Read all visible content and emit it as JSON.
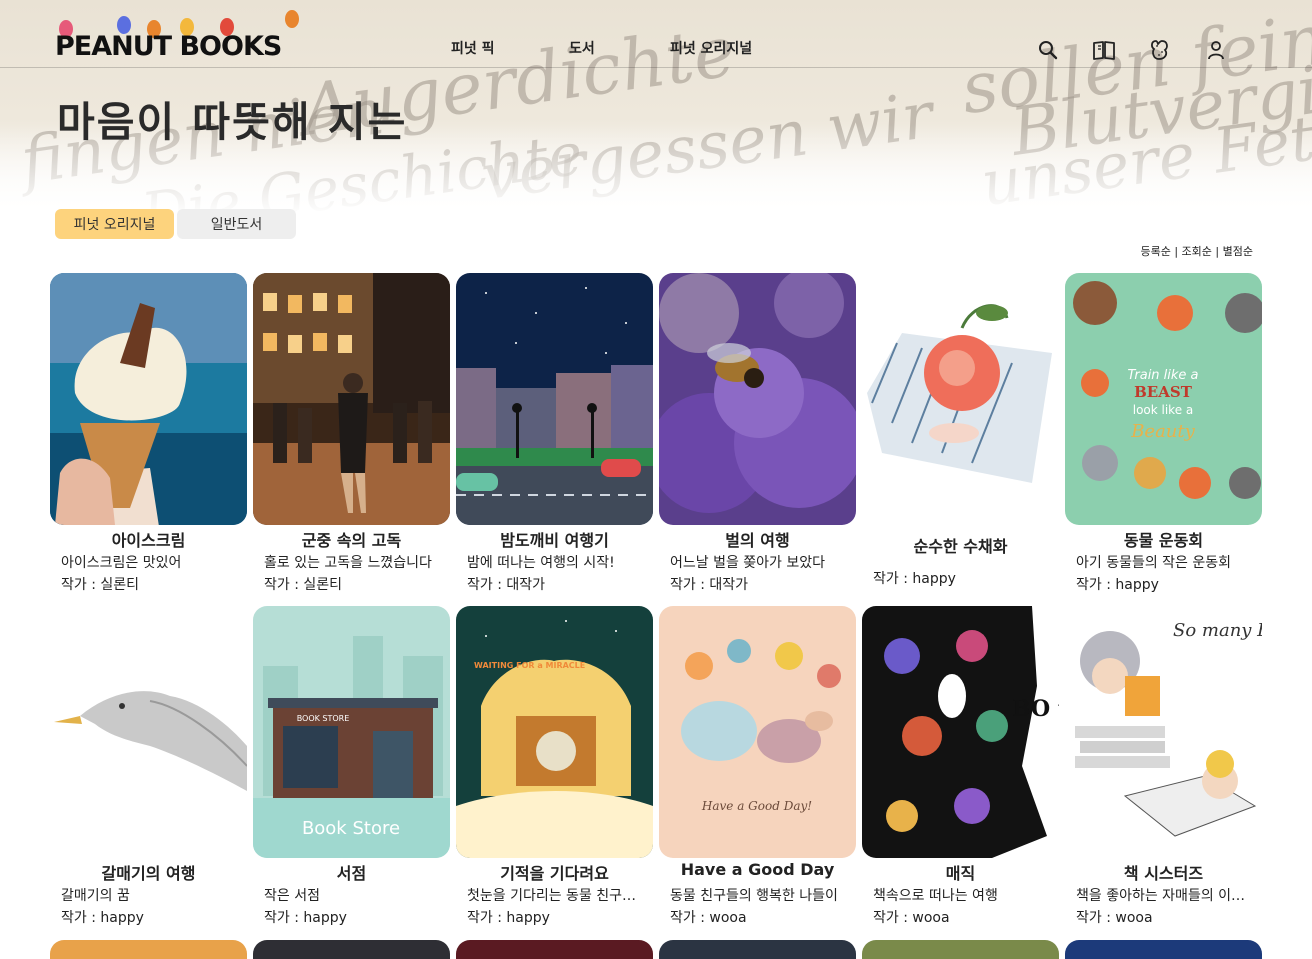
{
  "brand": {
    "logo_text": "PEANUT BOOKS"
  },
  "nav": [
    "피넛 픽",
    "도서",
    "피넛 오리지널"
  ],
  "header_icons": [
    "search-icon",
    "book-icon",
    "peanut-icon",
    "user-icon"
  ],
  "hero": {
    "title": "마음이 따뜻해 지는"
  },
  "tabs": [
    {
      "label": "피넛 오리지널",
      "active": true
    },
    {
      "label": "일반도서",
      "active": false
    }
  ],
  "sort": {
    "options": [
      "등록순",
      "조회순",
      "별점순"
    ],
    "separator": " | "
  },
  "colors": {
    "accent": "#fdd37d",
    "tab_inactive": "#eeeeee"
  },
  "books": [
    {
      "title": "아이스크림",
      "desc": "아이스크림은 맛있어",
      "author": "작가 : 실론티"
    },
    {
      "title": "군중 속의 고독",
      "desc": "홀로 있는 고독을 느꼈습니다",
      "author": "작가 : 실론티"
    },
    {
      "title": "밤도깨비 여행기",
      "desc": "밤에 떠나는 여행의 시작!",
      "author": "작가 : 대작가"
    },
    {
      "title": "벌의 여행",
      "desc": "어느날 벌을 쫒아가 보았다",
      "author": "작가 : 대작가"
    },
    {
      "title": "순수한 수채화",
      "desc": "",
      "author": "작가 : happy"
    },
    {
      "title": "동물 운동회",
      "desc": "아기 동물들의 작은 운동회",
      "author": "작가 : happy"
    },
    {
      "title": "갈매기의 여행",
      "desc": "갈매기의 꿈",
      "author": "작가 : happy"
    },
    {
      "title": "서점",
      "desc": "작은 서점",
      "author": "작가 : happy",
      "cover_text": "Book Store",
      "sign_text": "BOOK STORE"
    },
    {
      "title": "기적을 기다려요",
      "desc": "첫눈을 기다리는 동물 친구들의 이야기",
      "author": "작가 : happy",
      "cover_text": "WAITING FOR a MIRACLE"
    },
    {
      "title": "Have a Good Day",
      "desc": "동물 친구들의 행복한 나들이",
      "author": "작가 : wooa",
      "cover_text": "Have a Good Day!"
    },
    {
      "title": "매직",
      "desc": "책속으로 떠나는 여행",
      "author": "작가 : wooa",
      "cover_text": "BO un POR M"
    },
    {
      "title": "책 시스터즈",
      "desc": "책을 좋아하는 자매들의 이야기",
      "author": "작가 : wooa",
      "cover_text": "So many BOOKS so little TIME"
    }
  ],
  "cover_texts_row1": {
    "sport_line1": "Train like a",
    "sport_line2": "BEAST",
    "sport_line3": "look like a",
    "sport_line4": "Beauty"
  }
}
